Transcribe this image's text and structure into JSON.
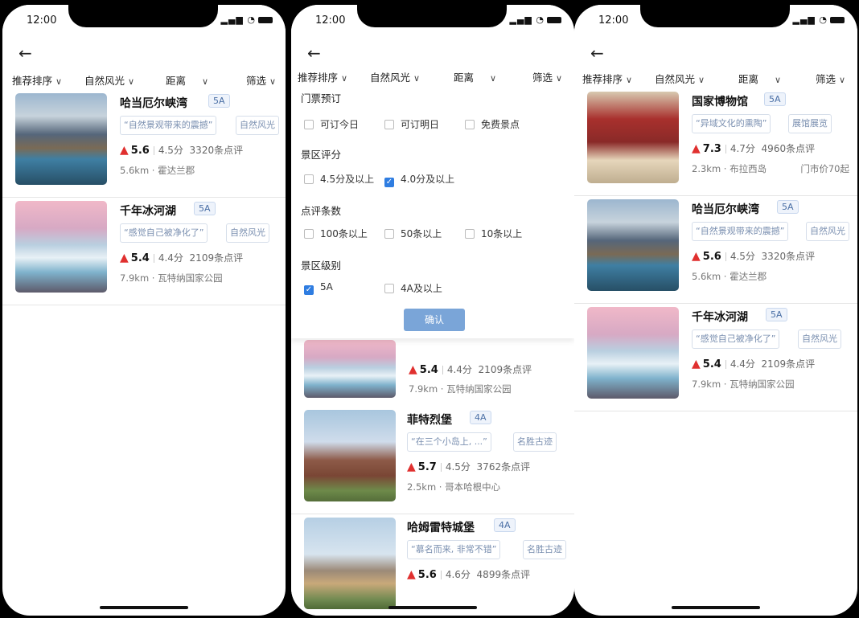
{
  "status": {
    "time": "12:00",
    "signal": "▂▄▆ ◔"
  },
  "filters": {
    "sort": "推荐排序",
    "category": "自然风光",
    "distance": "距离",
    "filter": "筛选",
    "arrow": "∨"
  },
  "back_glyph": "←",
  "like_glyph": "▲",
  "spots": {
    "hardanger": {
      "name": "哈当厄尔峡湾",
      "level": "5A",
      "quote": "“自然景观带来的震撼”",
      "tag": "自然风光",
      "hot": "5.6",
      "score": "4.5分",
      "reviews": "3320条点评",
      "location": "5.6km · 霍达兰郡"
    },
    "glacier": {
      "name": "千年冰河湖",
      "level": "5A",
      "quote": "“感觉自己被净化了”",
      "tag": "自然风光",
      "hot": "5.4",
      "score": "4.4分",
      "reviews": "2109条点评",
      "location": "7.9km · 瓦特纳国家公园"
    },
    "frederiksborg": {
      "name": "菲特烈堡",
      "level": "4A",
      "quote": "“在三个小岛上, ...”",
      "tag": "名胜古迹",
      "hot": "5.7",
      "score": "4.5分",
      "reviews": "3762条点评",
      "location": "2.5km · 哥本哈根中心"
    },
    "kronborg": {
      "name": "哈姆雷特城堡",
      "level": "4A",
      "quote": "“慕名而来, 非常不错”",
      "tag": "名胜古迹",
      "hot": "5.6",
      "score": "4.6分",
      "reviews": "4899条点评"
    },
    "museum": {
      "name": "国家博物馆",
      "level": "5A",
      "quote": "“异域文化的熏陶”",
      "tag": "展馆展览",
      "hot": "7.3",
      "score": "4.7分",
      "reviews": "4960条点评",
      "location": "2.3km · 布拉西岛",
      "price": "门市价70起"
    }
  },
  "filter_panel": {
    "ticket_title": "门票预订",
    "ticket_options": [
      "可订今日",
      "可订明日",
      "免费景点"
    ],
    "rating_title": "景区评分",
    "rating_options": [
      "4.5分及以上",
      "4.0分及以上"
    ],
    "rating_checked": [
      false,
      true
    ],
    "review_title": "点评条数",
    "review_options": [
      "100条以上",
      "50条以上",
      "10条以上"
    ],
    "level_title": "景区级别",
    "level_options": [
      "5A",
      "4A及以上"
    ],
    "level_checked": [
      true,
      false
    ],
    "confirm": "确认"
  },
  "colors": {
    "accent": "#2f7de1",
    "like": "#e0302f",
    "confirm_bg": "#7aa5d8"
  }
}
